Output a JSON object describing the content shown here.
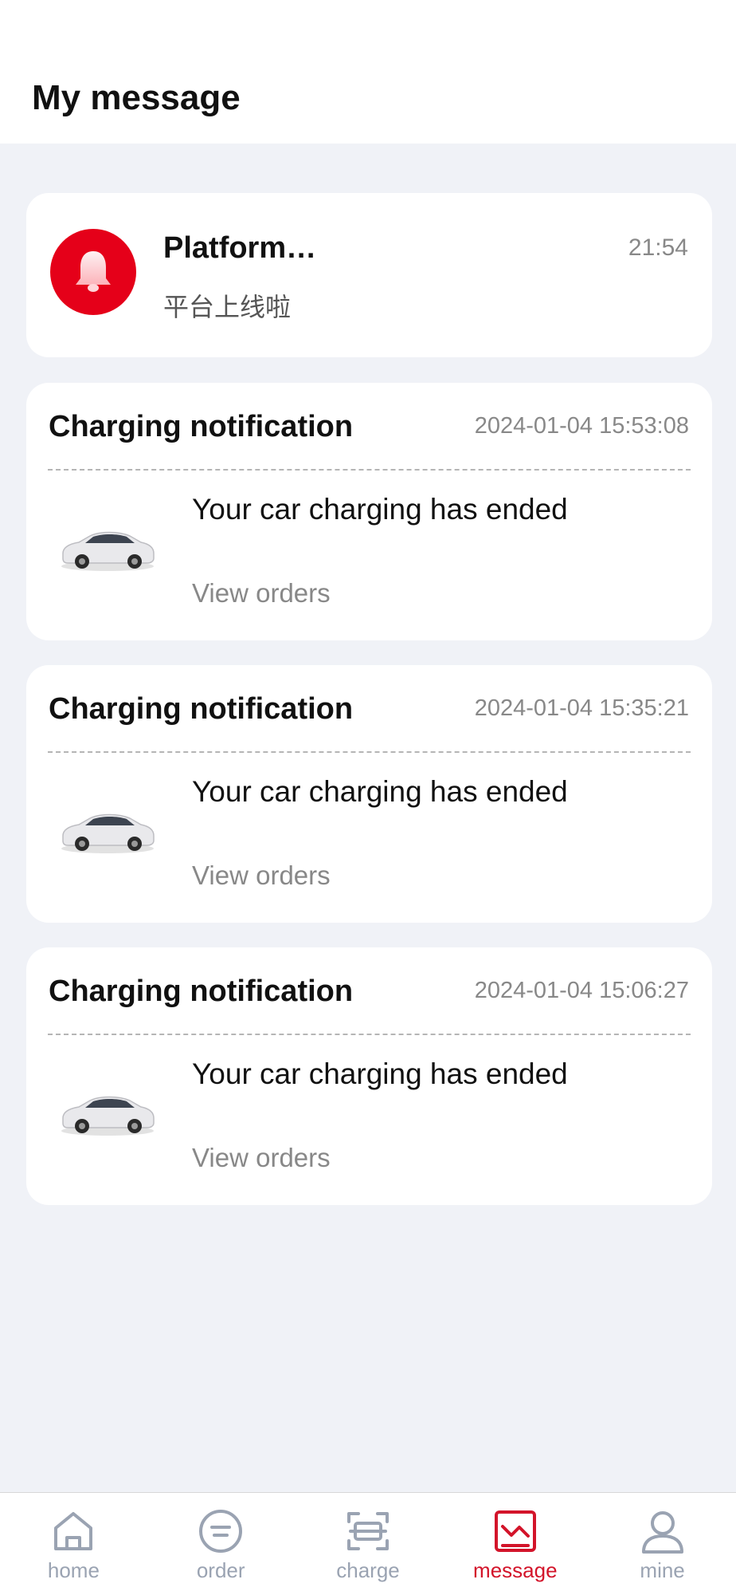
{
  "header": {
    "title": "My message"
  },
  "platform_message": {
    "title": "Platform…",
    "subtitle": "平台上线啦",
    "time": "21:54",
    "icon": "bell-icon",
    "avatar_color": "#e50019"
  },
  "notifications": [
    {
      "title": "Charging notification",
      "time": "2024-01-04 15:53:08",
      "message": "Your car charging has ended",
      "link": "View orders",
      "icon": "car-icon"
    },
    {
      "title": "Charging notification",
      "time": "2024-01-04 15:35:21",
      "message": "Your car charging has ended",
      "link": "View orders",
      "icon": "car-icon"
    },
    {
      "title": "Charging notification",
      "time": "2024-01-04 15:06:27",
      "message": "Your car charging has ended",
      "link": "View orders",
      "icon": "car-icon"
    }
  ],
  "tabbar": {
    "items": [
      {
        "label": "home",
        "icon": "home-icon",
        "active": false
      },
      {
        "label": "order",
        "icon": "order-icon",
        "active": false
      },
      {
        "label": "charge",
        "icon": "scan-icon",
        "active": false
      },
      {
        "label": "message",
        "icon": "message-icon",
        "active": true
      },
      {
        "label": "mine",
        "icon": "user-icon",
        "active": false
      }
    ],
    "active_color": "#d3142a",
    "inactive_color": "#9aa3b2"
  }
}
